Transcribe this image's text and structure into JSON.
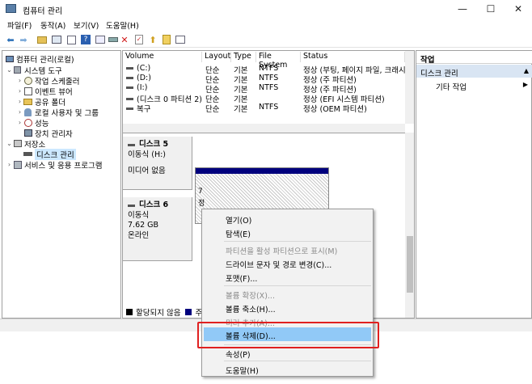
{
  "window": {
    "title": "컴퓨터 관리",
    "controls": {
      "minimize": "—",
      "maximize": "☐",
      "close": "✕"
    }
  },
  "menu": [
    "파일(F)",
    "동작(A)",
    "보기(V)",
    "도움말(H)"
  ],
  "toolbar": {
    "icons": [
      "back-arrow-icon",
      "forward-arrow-icon",
      "up-folder-icon",
      "show-tree-icon",
      "properties-icon",
      "help-icon",
      "view-icon",
      "connect-icon",
      "delete-icon",
      "checklist-icon",
      "export-icon",
      "wizard-icon",
      "console-icon"
    ]
  },
  "tree": {
    "root": "컴퓨터 관리(로컬)",
    "items": [
      {
        "label": "시스템 도구",
        "level": 1,
        "expander": "⌄"
      },
      {
        "label": "작업 스케줄러",
        "level": 2,
        "expander": "›"
      },
      {
        "label": "이벤트 뷰어",
        "level": 2,
        "expander": "›"
      },
      {
        "label": "공유 폴더",
        "level": 2,
        "expander": "›"
      },
      {
        "label": "로컬 사용자 및 그룹",
        "level": 2,
        "expander": "›"
      },
      {
        "label": "성능",
        "level": 2,
        "expander": "›"
      },
      {
        "label": "장치 관리자",
        "level": 2,
        "expander": ""
      },
      {
        "label": "저장소",
        "level": 1,
        "expander": "⌄"
      },
      {
        "label": "디스크 관리",
        "level": 2,
        "expander": "",
        "selected": true
      },
      {
        "label": "서비스 및 응용 프로그램",
        "level": 1,
        "expander": "›"
      }
    ]
  },
  "volumes": {
    "columns": [
      "Volume",
      "Layout",
      "Type",
      "File System",
      "Status"
    ],
    "rows": [
      [
        "(C:)",
        "단순",
        "기본",
        "NTFS",
        "정상 (부팅, 페이지 파일, 크래시 덤"
      ],
      [
        "(D:)",
        "단순",
        "기본",
        "NTFS",
        "정상 (주 파티션)"
      ],
      [
        "(I:)",
        "단순",
        "기본",
        "NTFS",
        "정상 (주 파티션)"
      ],
      [
        "(디스크 0 파티션 2)",
        "단순",
        "기본",
        "",
        "정상 (EFI 시스템 파티션)"
      ],
      [
        "복구",
        "단순",
        "기본",
        "NTFS",
        "정상 (OEM 파티션)"
      ]
    ]
  },
  "disks": [
    {
      "name": "디스크 5",
      "lines": [
        "이동식 (H:)",
        "",
        "미디어 없음"
      ]
    },
    {
      "name": "디스크 6",
      "lines": [
        "이동식",
        "7.62 GB",
        "온라인"
      ]
    }
  ],
  "partition6": {
    "text_top": "7",
    "text_mid": "정"
  },
  "legend": {
    "unallocated": "할당되지 않음",
    "primary_abbrev": "주"
  },
  "actions": {
    "header": "작업",
    "section": "디스크 관리",
    "item": "기타 작업"
  },
  "context_menu": {
    "items": [
      {
        "label": "열기(O)",
        "disabled": false
      },
      {
        "label": "탐색(E)",
        "disabled": false
      },
      {
        "sep": true
      },
      {
        "label": "파티션을 활성 파티션으로 표시(M)",
        "disabled": true
      },
      {
        "label": "드라이브 문자 및 경로 변경(C)...",
        "disabled": false
      },
      {
        "label": "포맷(F)...",
        "disabled": false
      },
      {
        "sep": true
      },
      {
        "label": "볼륨 확장(X)...",
        "disabled": true
      },
      {
        "label": "볼륨 축소(H)...",
        "disabled": false
      },
      {
        "label": "미러 추가(A)...",
        "disabled": true
      },
      {
        "label": "볼륨 삭제(D)...",
        "disabled": false,
        "highlighted": true
      },
      {
        "sep": true
      },
      {
        "label": "속성(P)",
        "disabled": false
      },
      {
        "sep": true
      },
      {
        "label": "도움말(H)",
        "disabled": false
      }
    ]
  },
  "colors": {
    "highlight": "#91c9f7",
    "annotation_box": "#e02020",
    "primary_partition": "#00007d"
  }
}
